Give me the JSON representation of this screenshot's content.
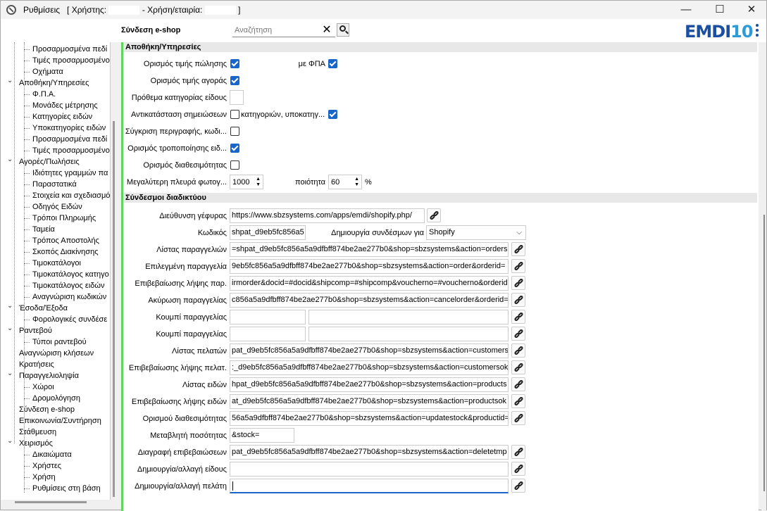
{
  "window": {
    "title_prefix": "Ρυθμίσεις   [ Χρήστης:",
    "title_mid": "- Χρήση/εταιρία:",
    "title_suffix": "]",
    "minimize": "—",
    "maximize": "☐",
    "close": "✕"
  },
  "topbar": {
    "section_label": "Σύνδεση e-shop",
    "search_placeholder": "Αναζήτηση",
    "logo_main": "EMDI",
    "logo_num": "10"
  },
  "sidebar": {
    "items": [
      {
        "label": "Προσαρμοσμένα πεδί",
        "level": 2
      },
      {
        "label": "Τιμές προσαρμοσμένο",
        "level": 2
      },
      {
        "label": "Οχήματα",
        "level": 2
      },
      {
        "label": "Αποθήκη/Υπηρεσίες",
        "level": 1,
        "expanded": true
      },
      {
        "label": "Φ.Π.Α.",
        "level": 2
      },
      {
        "label": "Μονάδες μέτρησης",
        "level": 2
      },
      {
        "label": "Κατηγορίες ειδών",
        "level": 2
      },
      {
        "label": "Υποκατηγορίες ειδών",
        "level": 2
      },
      {
        "label": "Προσαρμοσμένα πεδί",
        "level": 2
      },
      {
        "label": "Τιμές προσαρμοσμένο",
        "level": 2
      },
      {
        "label": "Αγορές/Πωλήσεις",
        "level": 1,
        "expanded": true
      },
      {
        "label": "Ιδιότητες γραμμών πα",
        "level": 2
      },
      {
        "label": "Παραστατικά",
        "level": 2
      },
      {
        "label": "Στοιχεία και σχεδιασμό",
        "level": 2
      },
      {
        "label": "Οδηγός Ειδών",
        "level": 2
      },
      {
        "label": "Τρόποι Πληρωμής",
        "level": 2
      },
      {
        "label": "Ταμεία",
        "level": 2
      },
      {
        "label": "Τρόπος Αποστολής",
        "level": 2
      },
      {
        "label": "Σκοπός Διακίνησης",
        "level": 2
      },
      {
        "label": "Τιμοκατάλογοι",
        "level": 2
      },
      {
        "label": "Τιμοκατάλογος κατηγο",
        "level": 2
      },
      {
        "label": "Τιμοκατάλογος ειδών",
        "level": 2
      },
      {
        "label": "Αναγνώριση κωδικών",
        "level": 2
      },
      {
        "label": "Έσοδα/Έξοδα",
        "level": 1,
        "expanded": true
      },
      {
        "label": "Φορολογικές συνδέσε",
        "level": 2
      },
      {
        "label": "Ραντεβού",
        "level": 1,
        "expanded": true
      },
      {
        "label": "Τύποι ραντεβού",
        "level": 2
      },
      {
        "label": "Αναγνώριση κλήσεων",
        "level": 1
      },
      {
        "label": "Κρατήσεις",
        "level": 1
      },
      {
        "label": "Παραγγελιοληψία",
        "level": 1,
        "expanded": true
      },
      {
        "label": "Χώροι",
        "level": 2
      },
      {
        "label": "Δρομολόγηση",
        "level": 2
      },
      {
        "label": "Σύνδεση e-shop",
        "level": 1
      },
      {
        "label": "Επικοινωνία/Συντήρηση",
        "level": 1
      },
      {
        "label": "Στάθμευση",
        "level": 1
      },
      {
        "label": "Χειρισμός",
        "level": 1,
        "expanded": true
      },
      {
        "label": "Δικαιώματα",
        "level": 2
      },
      {
        "label": "Χρήστες",
        "level": 2
      },
      {
        "label": "Χρήση",
        "level": 2
      },
      {
        "label": "Ρυθμίσεις στη βάση",
        "level": 2
      }
    ]
  },
  "warehouse": {
    "header": "Αποθήκη/Υπηρεσίες",
    "set_sale_price": {
      "label": "Ορισμός τιμής πώλησης",
      "checked": true
    },
    "with_vat": {
      "label": "με ΦΠΑ",
      "checked": true
    },
    "set_buy_price": {
      "label": "Ορισμός τιμής αγοράς",
      "checked": true
    },
    "category_prefix": {
      "label": "Πρόθεμα κατηγορίας είδους",
      "value": ""
    },
    "replace_notes": {
      "label": "Αντικατάσταση σημειώσεων",
      "checked": false
    },
    "categories_sub": {
      "label": "κατηγοριών, υποκατηγ...",
      "checked": true
    },
    "sync_desc": {
      "label": "Σύγκριση περιγραφής, κωδι...",
      "checked": false
    },
    "set_modification": {
      "label": "Ορισμός τροποποίησης ειδ...",
      "checked": true
    },
    "set_availability": {
      "label": "Ορισμός διαθεσιμότητας",
      "checked": false
    },
    "max_photo_side": {
      "label": "Μεγαλύτερη πλευρά φωτογ...",
      "value": "1000"
    },
    "quality": {
      "label": "ποιότητα",
      "value": "60",
      "unit": "%"
    }
  },
  "links": {
    "header": "Σύνδεσμοι διαδικτύου",
    "bridge": {
      "label": "Διεύθυνση γέφυρας",
      "value": "https://www.sbzsystems.com/apps/emdi/shopify.php/"
    },
    "code": {
      "label": "Κωδικός",
      "value": "shpat_d9eb5fc856a5"
    },
    "create_links": {
      "label": "Δημιουργία συνδέσμων για",
      "value": "Shopify"
    },
    "rows": [
      {
        "label": "Λίστας παραγγελιών",
        "value": "=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&shop=sbzsystems&action=orders"
      },
      {
        "label": "Επιλεγμένη παραγγελία",
        "value": "9eb5fc856a5a9dfbff874be2ae277b0&shop=sbzsystems&action=order&orderid="
      },
      {
        "label": "Επιβεβαίωσης λήψης παρ.",
        "value": "irmorder&docid=#docid&shipcomp=#shipcomp&voucherno=#voucherno&orderid="
      },
      {
        "label": "Ακύρωση παραγγελίας",
        "value": "c856a5a9dfbff874be2ae277b0&shop=sbzsystems&action=cancelorder&orderid="
      }
    ],
    "button1": {
      "label": "Κουμπί παραγγελίας",
      "v1": "",
      "v2": ""
    },
    "button2": {
      "label": "Κουμπί παραγγελίας",
      "v1": "",
      "v2": ""
    },
    "rows2": [
      {
        "label": "Λίστας πελατών",
        "value": "pat_d9eb5fc856a5a9dfbff874be2ae277b0&shop=sbzsystems&action=customers"
      },
      {
        "label": "Επιβεβαίωσης λήψης πελατ.",
        "value": ":_d9eb5fc856a5a9dfbff874be2ae277b0&shop=sbzsystems&action=customersok"
      },
      {
        "label": "Λίστας ειδών",
        "value": "hpat_d9eb5fc856a5a9dfbff874be2ae277b0&shop=sbzsystems&action=products"
      },
      {
        "label": "Επιβεβαίωσης λήψης ειδών",
        "value": "at_d9eb5fc856a5a9dfbff874be2ae277b0&shop=sbzsystems&action=productsok"
      },
      {
        "label": "Ορισμού διαθεσιμότητας",
        "value": "56a5a9dfbff874be2ae277b0&shop=sbzsystems&action=updatestock&productid="
      }
    ],
    "qty_var": {
      "label": "Μεταβλητή ποσότητας",
      "value": "&stock="
    },
    "delete_confirm": {
      "label": "Διαγραφή επιβεβαιώσεων",
      "value": "pat_d9eb5fc856a5a9dfbff874be2ae277b0&shop=sbzsystems&action=deletetmp"
    },
    "create_item": {
      "label": "Δημιουργία/αλλαγή είδους",
      "value": ""
    },
    "create_customer": {
      "label": "Δημιουργία/αλλαγή πελάτη",
      "value": ""
    }
  },
  "colors": {
    "accent": "#1a66c8",
    "logo": "#1b4fa0",
    "green_bar": "#5cd65c"
  }
}
